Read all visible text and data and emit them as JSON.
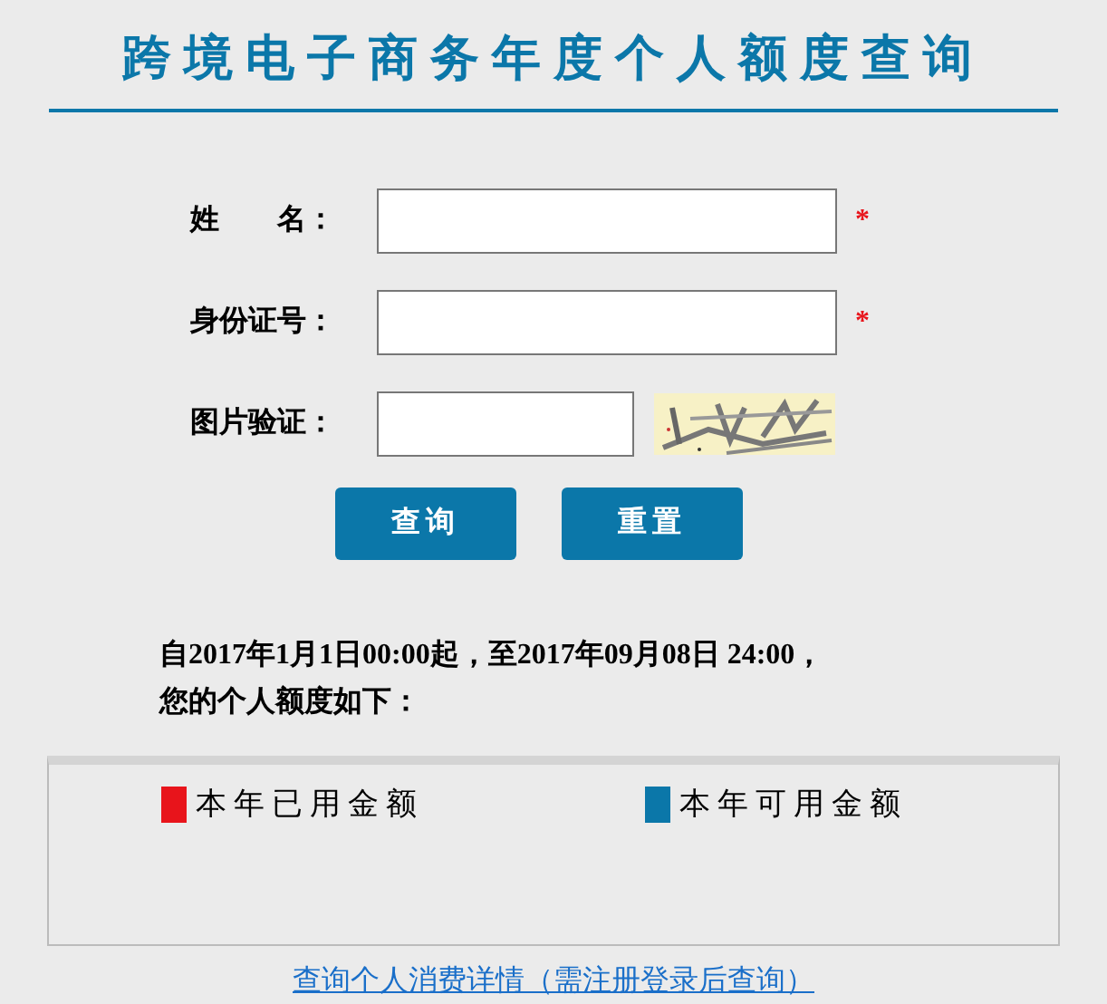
{
  "title": "跨境电子商务年度个人额度查询",
  "fields": [
    {
      "kind": "text",
      "label": "姓　　名：",
      "required": true
    },
    {
      "kind": "text",
      "label": "身份证号：",
      "required": true
    },
    {
      "kind": "captcha",
      "label": "图片验证：",
      "required": false
    }
  ],
  "required_mark": "*",
  "buttons": [
    "查询",
    "重置"
  ],
  "notice": [
    "自2017年1月1日00:00起，至2017年09月08日 24:00，",
    "您的个人额度如下："
  ],
  "legend": [
    {
      "label": "本年已用金额",
      "color": "#e8141b"
    },
    {
      "label": "本年可用金额",
      "color": "#0b77a9"
    }
  ],
  "link": "查询个人消费详情（需注册登录后查询）"
}
